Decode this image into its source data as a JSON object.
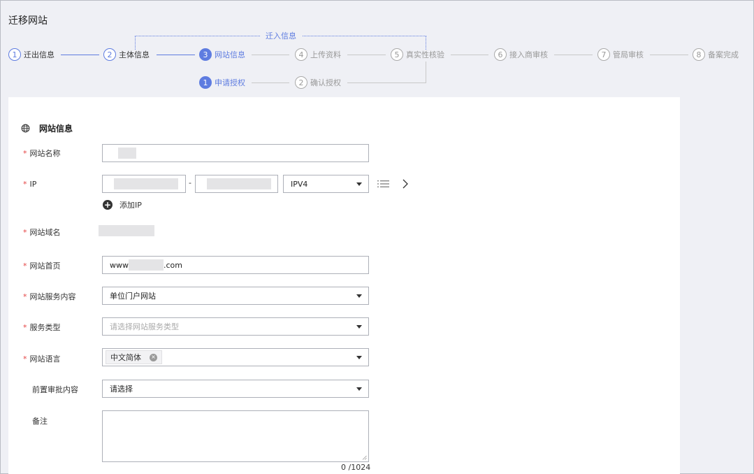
{
  "page": {
    "title": "迁移网站"
  },
  "steps": {
    "group_label": "迁入信息",
    "main": [
      {
        "num": "1",
        "label": "迁出信息",
        "state": "done"
      },
      {
        "num": "2",
        "label": "主体信息",
        "state": "done"
      },
      {
        "num": "3",
        "label": "网站信息",
        "state": "active"
      },
      {
        "num": "4",
        "label": "上传资料",
        "state": "todo"
      },
      {
        "num": "5",
        "label": "真实性核验",
        "state": "todo"
      },
      {
        "num": "6",
        "label": "接入商审核",
        "state": "todo"
      },
      {
        "num": "7",
        "label": "管局审核",
        "state": "todo"
      },
      {
        "num": "8",
        "label": "备案完成",
        "state": "todo"
      }
    ],
    "sub": [
      {
        "num": "1",
        "label": "申请授权",
        "state": "active"
      },
      {
        "num": "2",
        "label": "确认授权",
        "state": "todo"
      }
    ]
  },
  "form": {
    "section_title": "网站信息",
    "required_mark": "*",
    "site_name": {
      "label": "网站名称"
    },
    "ip": {
      "label": "IP",
      "range_separator": "-",
      "version_value": "IPV4",
      "add_label": "添加IP"
    },
    "domain": {
      "label": "网站域名"
    },
    "homepage": {
      "label": "网站首页",
      "prefix": "www",
      "suffix": ".com"
    },
    "service_content": {
      "label": "网站服务内容",
      "value": "单位门户网站"
    },
    "service_type": {
      "label": "服务类型",
      "placeholder": "请选择网站服务类型"
    },
    "language": {
      "label": "网站语言",
      "tag": "中文简体"
    },
    "pre_approval": {
      "label": "前置审批内容",
      "value": "请选择"
    },
    "remark": {
      "label": "备注",
      "counter": "0 /1024"
    }
  },
  "colors": {
    "accent": "#5e7ce0",
    "required": "#e54545",
    "background": "#eff0f5"
  },
  "icons": [
    "globe-icon",
    "list-icon",
    "chevron-right-icon",
    "plus-circle-icon",
    "clear-tag-icon",
    "caret-down-icon"
  ]
}
